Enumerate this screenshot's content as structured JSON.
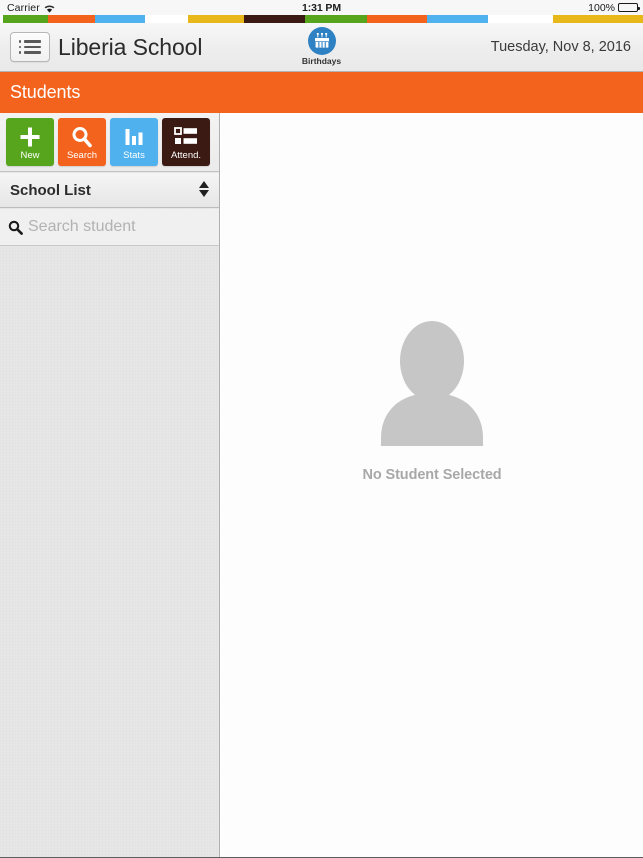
{
  "status_bar": {
    "carrier": "Carrier",
    "wifi_icon": "wifi-icon",
    "time": "1:31 PM",
    "battery_percent": "100%",
    "battery_icon": "battery-full-icon"
  },
  "stripes": [
    {
      "color": "#ffffff",
      "width": 3
    },
    {
      "color": "#57a51d",
      "width": 45
    },
    {
      "color": "#f4631e",
      "width": 47
    },
    {
      "color": "#4fb1ee",
      "width": 50
    },
    {
      "color": "#ffffff",
      "width": 43
    },
    {
      "color": "#e8b81b",
      "width": 56
    },
    {
      "color": "#3a1a13",
      "width": 61
    },
    {
      "color": "#57a51d",
      "width": 62
    },
    {
      "color": "#f4631e",
      "width": 60
    },
    {
      "color": "#4fb1ee",
      "width": 61
    },
    {
      "color": "#ffffff",
      "width": 65
    },
    {
      "color": "#e8b81b",
      "width": 90
    }
  ],
  "nav_bar": {
    "menu_icon": "hamburger-list-icon",
    "title": "Liberia School",
    "birthdays": {
      "icon": "birthday-cake-icon",
      "label": "Birthdays",
      "circle_color": "#2e82c4"
    },
    "date": "Tuesday, Nov 8, 2016"
  },
  "section_header": {
    "title": "Students",
    "background": "#f4631e"
  },
  "sidebar": {
    "toolbar": [
      {
        "label": "New",
        "icon": "plus-icon",
        "color": "#57a51d"
      },
      {
        "label": "Search",
        "icon": "magnifier-icon",
        "color": "#f4631e"
      },
      {
        "label": "Stats",
        "icon": "bar-chart-icon",
        "color": "#4fb1ee"
      },
      {
        "label": "Attend.",
        "icon": "checklist-icon",
        "color": "#3a1a13"
      }
    ],
    "list_header": {
      "title": "School List",
      "sort_icon": "sort-up-down-icon"
    },
    "search": {
      "icon": "search-icon",
      "value": "",
      "placeholder": "Search student"
    },
    "students": []
  },
  "main_panel": {
    "empty_state": {
      "icon": "person-placeholder-icon",
      "label": "No Student Selected",
      "icon_color": "#c6c6c6",
      "label_color": "#a8a8a8"
    }
  }
}
